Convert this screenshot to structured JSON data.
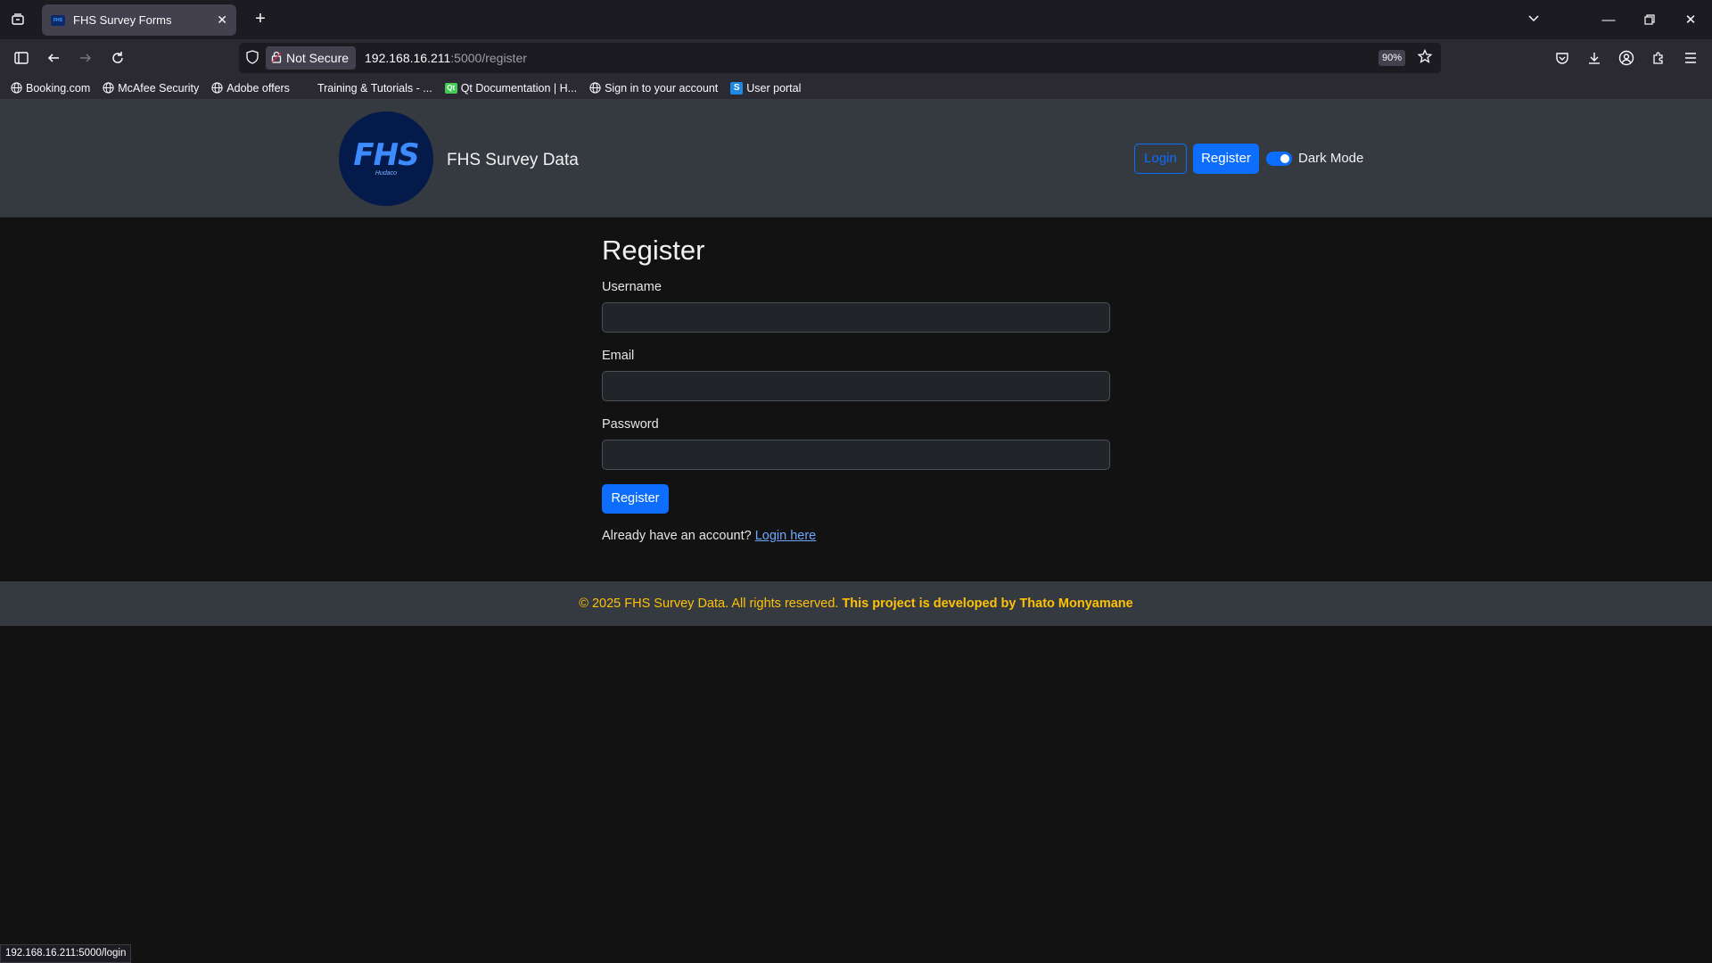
{
  "browser": {
    "tab_title": "FHS Survey Forms",
    "favicon_text": "FHS",
    "url_host": "192.168.16.211",
    "url_path": ":5000/register",
    "security_label": "Not Secure",
    "zoom": "90%",
    "status_url": "192.168.16.211:5000/login",
    "bookmarks": [
      {
        "label": "Booking.com",
        "icon": "globe-icon"
      },
      {
        "label": "McAfee Security",
        "icon": "globe-icon"
      },
      {
        "label": "Adobe offers",
        "icon": "globe-icon"
      },
      {
        "label": "Training & Tutorials - ...",
        "icon": "generic-icon"
      },
      {
        "label": "Qt Documentation | H...",
        "icon": "qt-icon"
      },
      {
        "label": "Sign in to your account",
        "icon": "globe-icon"
      },
      {
        "label": "User portal",
        "icon": "s-icon"
      }
    ]
  },
  "header": {
    "logo_text": "FHS",
    "logo_subtext": "Hudaco",
    "brand_name": "FHS Survey Data",
    "login_label": "Login",
    "register_label": "Register",
    "dark_mode_label": "Dark Mode",
    "dark_mode_on": true
  },
  "form": {
    "title": "Register",
    "username_label": "Username",
    "username_value": "",
    "email_label": "Email",
    "email_value": "",
    "password_label": "Password",
    "password_value": "",
    "submit_label": "Register",
    "already_text": "Already have an account?",
    "login_link": "Login here"
  },
  "footer": {
    "copyright": "© 2025 FHS Survey Data. All rights reserved.",
    "developer": "This project is developed by Thato Monyamane"
  },
  "colors": {
    "accent": "#0d6efd",
    "footer_text": "#ffc107",
    "header_bg": "#343a40",
    "page_bg": "#121212"
  }
}
